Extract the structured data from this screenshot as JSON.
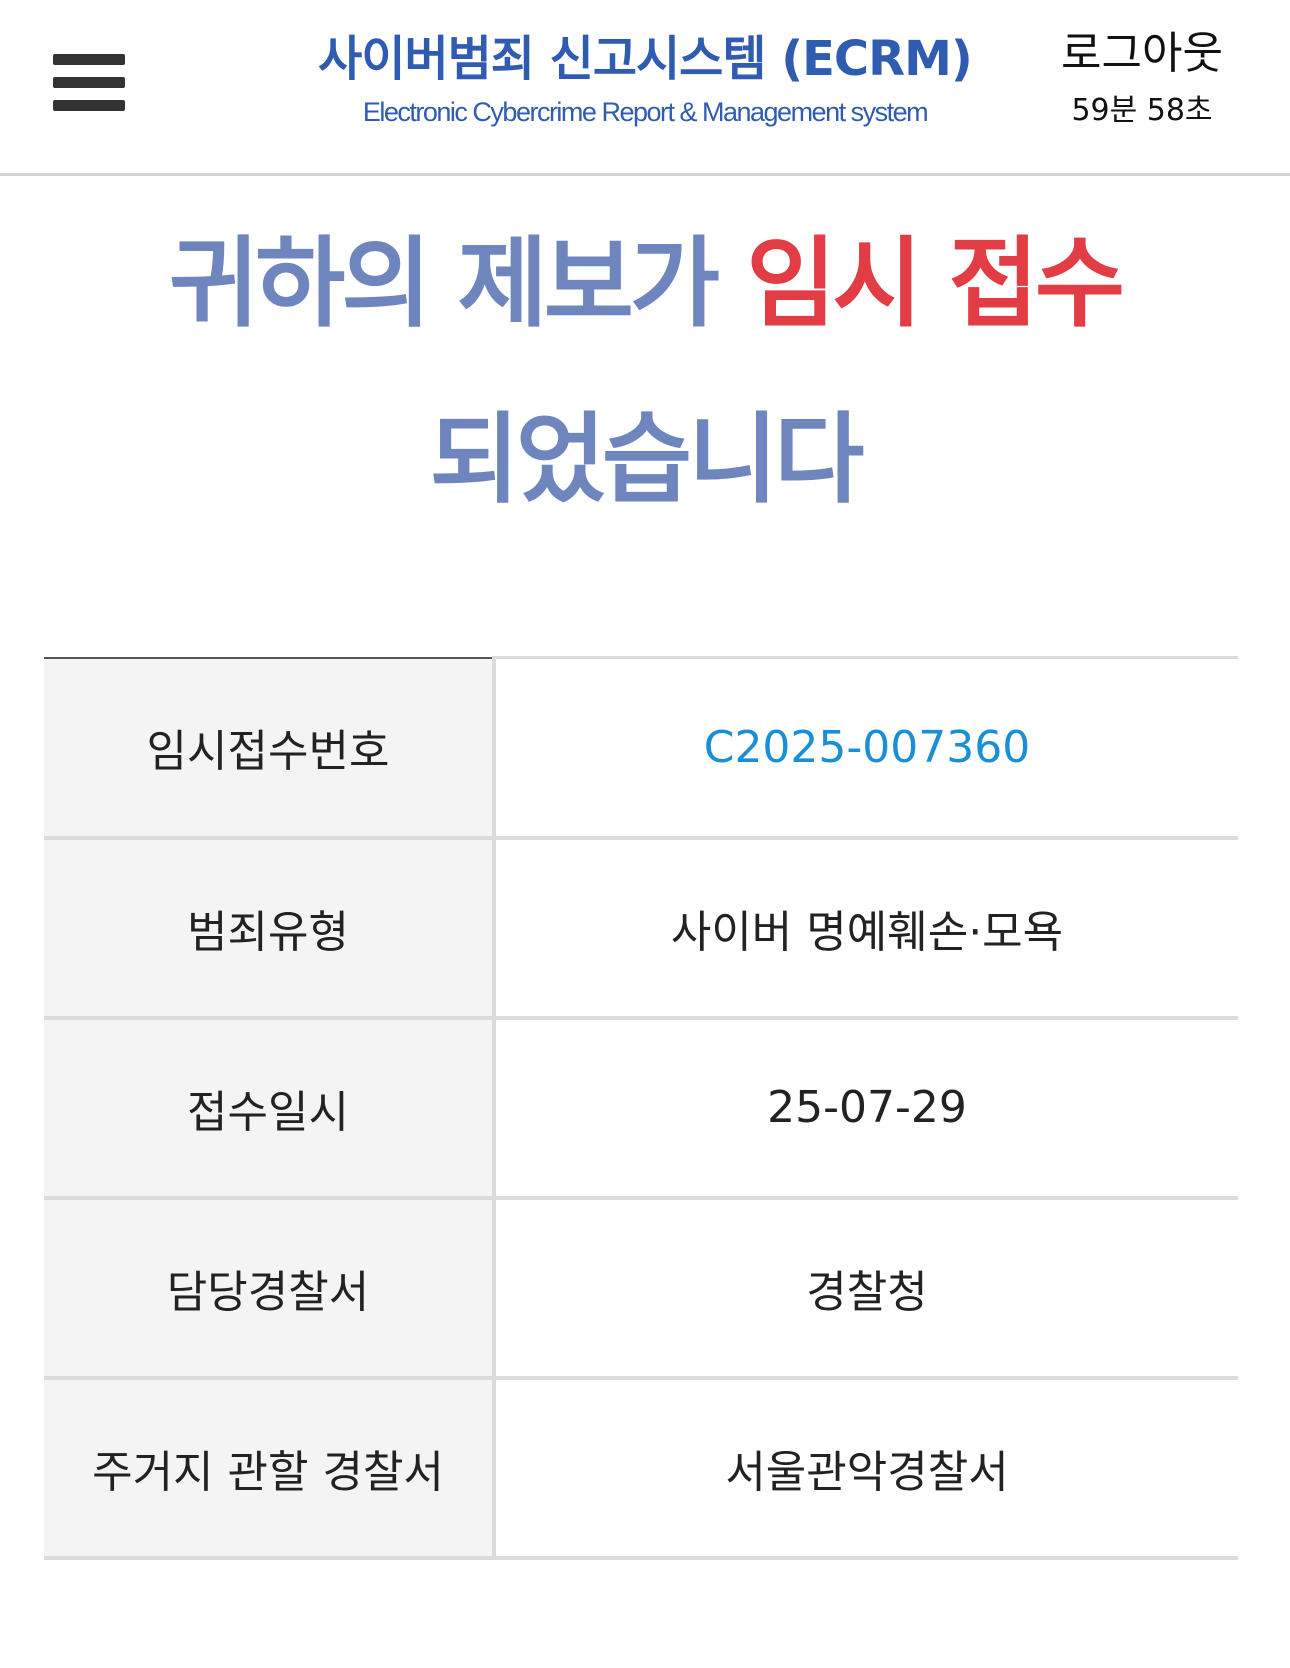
{
  "header": {
    "menu_icon": "hamburger-menu-icon",
    "title": "사이버범죄 신고시스템 (ECRM)",
    "subtitle": "Electronic Cybercrime Report & Management system",
    "logout_label": "로그아웃",
    "session_timer": "59분 58초"
  },
  "headline": {
    "part1": "귀하의 제보가 ",
    "highlight": "임시 접수",
    "part2": "되었습니다"
  },
  "colors": {
    "brand_blue": "#2f5bb0",
    "headline_blue": "#6f85be",
    "highlight_red": "#e23c44",
    "receipt_number_blue": "#1a8fd6"
  },
  "details": [
    {
      "label": "임시접수번호",
      "value": "C2025-007360"
    },
    {
      "label": "범죄유형",
      "value": "사이버 명예훼손·모욕"
    },
    {
      "label": "접수일시",
      "value": "25-07-29"
    },
    {
      "label": "담당경찰서",
      "value": "경찰청"
    },
    {
      "label": "주거지 관할 경찰서",
      "value": "서울관악경찰서"
    }
  ]
}
